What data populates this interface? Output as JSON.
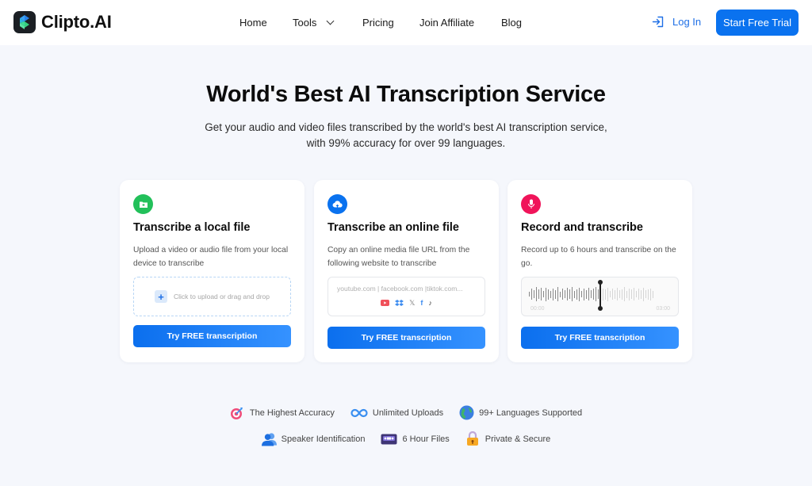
{
  "brand": {
    "name": "Clipto.AI"
  },
  "nav": {
    "items": [
      {
        "label": "Home"
      },
      {
        "label": "Tools",
        "has_dropdown": true
      },
      {
        "label": "Pricing"
      },
      {
        "label": "Join Affiliate"
      },
      {
        "label": "Blog"
      }
    ],
    "login_label": "Log In",
    "cta_label": "Start Free Trial"
  },
  "hero": {
    "title": "World's Best AI Transcription Service",
    "subtitle_line1": "Get your audio and video files transcribed by the world's best AI transcription service,",
    "subtitle_line2": "with 99% accuracy for over 99 languages."
  },
  "cards": [
    {
      "icon": "folder-plus-icon",
      "icon_color": "#22c05a",
      "title": "Transcribe a local file",
      "description": "Upload a video or audio file from your local device to transcribe",
      "dropzone_text": "Click to upload or drag and drop",
      "button_label": "Try FREE transcription"
    },
    {
      "icon": "cloud-upload-icon",
      "icon_color": "#0a72ef",
      "title": "Transcribe an online file",
      "description": "Copy an online media file URL from the following website to transcribe",
      "url_placeholder": "youtube.com | facebook.com |tiktok.com...",
      "platforms": [
        "youtube",
        "dropbox",
        "x",
        "facebook",
        "tiktok"
      ],
      "button_label": "Try FREE transcription"
    },
    {
      "icon": "microphone-icon",
      "icon_color": "#f0145a",
      "title": "Record and transcribe",
      "description": "Record up to 6 hours and transcribe on the go.",
      "time_start": "00:00",
      "time_end": "03:00",
      "button_label": "Try FREE transcription"
    }
  ],
  "features_row1": [
    {
      "icon": "target-icon",
      "label": "The Highest Accuracy"
    },
    {
      "icon": "infinity-icon",
      "label": "Unlimited Uploads"
    },
    {
      "icon": "globe-icon",
      "label": "99+ Languages Supported"
    }
  ],
  "features_row2": [
    {
      "icon": "speakers-icon",
      "label": "Speaker Identification"
    },
    {
      "icon": "cassette-icon",
      "label": "6 Hour Files"
    },
    {
      "icon": "lock-icon",
      "label": "Private & Secure"
    }
  ],
  "colors": {
    "accent": "#0a72ef",
    "background": "#f5f7fc"
  }
}
